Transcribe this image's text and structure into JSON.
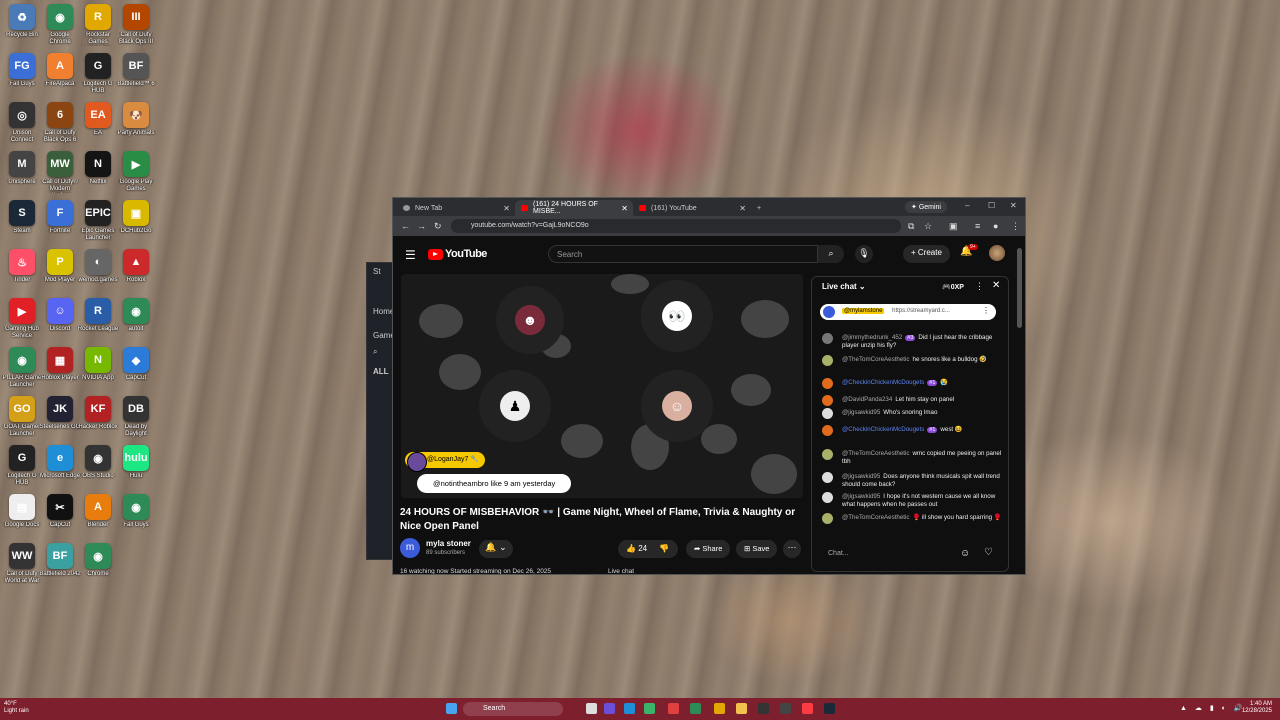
{
  "desktop": {
    "icons": [
      {
        "label": "Recycle Bin",
        "glyph": "♻",
        "color": "#4a7bb7"
      },
      {
        "label": "Google Chrome",
        "glyph": "◉",
        "color": "#2e8b57"
      },
      {
        "label": "Rockstar Games Launcher",
        "glyph": "R",
        "color": "#e0a800"
      },
      {
        "label": "Call of Duty Black Ops III",
        "glyph": "III",
        "color": "#b34700"
      },
      {
        "label": "Fall Guys",
        "glyph": "FG",
        "color": "#3b6fd6"
      },
      {
        "label": "FireAlpaca",
        "glyph": "A",
        "color": "#f08030"
      },
      {
        "label": "Logitech G HUB",
        "glyph": "G",
        "color": "#222222"
      },
      {
        "label": "Battlefield™ 6",
        "glyph": "BF",
        "color": "#555555"
      },
      {
        "label": "Unison Connect",
        "glyph": "◎",
        "color": "#333333"
      },
      {
        "label": "Call of Duty Black Ops 6",
        "glyph": "6",
        "color": "#8b4513"
      },
      {
        "label": "EA",
        "glyph": "EA",
        "color": "#e05a1f"
      },
      {
        "label": "Party Animals",
        "glyph": "🐶",
        "color": "#d98c3f"
      },
      {
        "label": "Unisphere",
        "glyph": "M",
        "color": "#444444"
      },
      {
        "label": "Call of Duty® Modern Warfare",
        "glyph": "MW",
        "color": "#3a5f3a"
      },
      {
        "label": "Netflix",
        "glyph": "N",
        "color": "#141414"
      },
      {
        "label": "Google Play Games",
        "glyph": "▶",
        "color": "#2a8d46"
      },
      {
        "label": "Steam",
        "glyph": "S",
        "color": "#1b2838"
      },
      {
        "label": "Fortnite",
        "glyph": "F",
        "color": "#3a6fd8"
      },
      {
        "label": "Epic Games Launcher",
        "glyph": "EPIC",
        "color": "#222222"
      },
      {
        "label": "DCHub2Go",
        "glyph": "▣",
        "color": "#d9b800"
      },
      {
        "label": "Tinder",
        "glyph": "♨",
        "color": "#fd5068"
      },
      {
        "label": "Mod Player",
        "glyph": "P",
        "color": "#d9c200"
      },
      {
        "label": "wemod.games",
        "glyph": "◐",
        "color": "#666666"
      },
      {
        "label": "Roblox",
        "glyph": "▲",
        "color": "#cc2a2a"
      },
      {
        "label": "Gaming Hub Service",
        "glyph": "▶",
        "color": "#e01f26"
      },
      {
        "label": "Discord",
        "glyph": "☺",
        "color": "#5865f2"
      },
      {
        "label": "Rocket League",
        "glyph": "R",
        "color": "#2a5da8"
      },
      {
        "label": "autoit",
        "glyph": "◉",
        "color": "#2e8b57"
      },
      {
        "label": "PILLAR Game Launcher",
        "glyph": "◉",
        "color": "#2e8b57"
      },
      {
        "label": "Roblox Player",
        "glyph": "▦",
        "color": "#b22222"
      },
      {
        "label": "NVIDIA App",
        "glyph": "N",
        "color": "#76b900"
      },
      {
        "label": "CapCut",
        "glyph": "◆",
        "color": "#2b7bd8"
      },
      {
        "label": "GOAT Gamer Launcher",
        "glyph": "GO",
        "color": "#d4a017"
      },
      {
        "label": "Steelseries GG",
        "glyph": "JK",
        "color": "#222233"
      },
      {
        "label": "Hacker Roblox",
        "glyph": "KF",
        "color": "#b22222"
      },
      {
        "label": "Dead by Daylight",
        "glyph": "DB",
        "color": "#333333"
      },
      {
        "label": "Logitech G HUB",
        "glyph": "G",
        "color": "#222222"
      },
      {
        "label": "Microsoft Edge",
        "glyph": "e",
        "color": "#1e8fd6"
      },
      {
        "label": "OBS Studio",
        "glyph": "◉",
        "color": "#333333"
      },
      {
        "label": "Hulu",
        "glyph": "hulu",
        "color": "#1ce783"
      },
      {
        "label": "Google Docs",
        "glyph": "▤",
        "color": "#eeeeee"
      },
      {
        "label": "CapCut",
        "glyph": "✂",
        "color": "#111111"
      },
      {
        "label": "Blender",
        "glyph": "A",
        "color": "#e87d0d"
      },
      {
        "label": "Fall Guys",
        "glyph": "◉",
        "color": "#2e8b57"
      },
      {
        "label": "Call of Duty World at War",
        "glyph": "WW",
        "color": "#333333"
      },
      {
        "label": "Battlefield 2042",
        "glyph": "BF",
        "color": "#3aa0a0"
      },
      {
        "label": "Chrome",
        "glyph": "◉",
        "color": "#2e8b57"
      }
    ]
  },
  "side_window": {
    "items": [
      "St",
      "Home",
      "Game",
      "ALL"
    ]
  },
  "browser": {
    "tabs": [
      {
        "label": "New Tab",
        "favicon": "gray"
      },
      {
        "label": "(161) 24 HOURS OF MISBE...",
        "favicon": "red"
      },
      {
        "label": "(161) YouTube",
        "favicon": "red"
      }
    ],
    "new_tab": "+",
    "gemini": "Gemini",
    "window_controls": [
      "–",
      "☐",
      "✕"
    ],
    "url": "youtube.com/watch?v=GajL9oNCO9o",
    "nav": [
      "←",
      "→",
      "↻"
    ]
  },
  "youtube": {
    "logo": "YouTube",
    "search_placeholder": "Search",
    "create_label": "Create",
    "notif_badge": "9+",
    "video": {
      "tag_user": "@LoganJay7",
      "caption": "@notintheambro like 9 am yesterday"
    },
    "title": "24 HOURS OF MISBEHAVIOR 👓 | Game Night, Wheel of Flame, Trivia & Naughty or Nice Open Panel",
    "channel": "myla stoner",
    "subscribers": "89 subscribers",
    "channel_initial": "m",
    "likes": "24",
    "share_label": "Share",
    "save_label": "Save",
    "description_preview": "16 watching now  Started streaming on Dec 26, 2025",
    "live_chat_bottom": "Live chat"
  },
  "chat": {
    "header": "Live chat",
    "points": "0XP",
    "pinned_user": "@mylamstone",
    "pinned_text": "https://streamyard.c...",
    "messages": [
      {
        "author": "@jimmythedrunk_452",
        "badge": "#3",
        "text": "Did I just hear the cribbage player unzip his fly?",
        "blue": false,
        "av": "#777"
      },
      {
        "author": "@TheTomCoreAesthetic",
        "badge": "",
        "text": "he snores like a bulldog 🤣",
        "blue": false,
        "av": "#a9b06a"
      },
      {
        "author": "@CheckinChickenMcDougets",
        "badge": "#1",
        "text": "😭",
        "blue": true,
        "av": "#e06b1f"
      },
      {
        "author": "@DavidPanda234",
        "badge": "",
        "text": "Let him stay on panel",
        "blue": false,
        "av": "#e06b1f"
      },
      {
        "author": "@jigsawkid95",
        "badge": "",
        "text": "Who's snoring lmao",
        "blue": false,
        "av": "#ddd"
      },
      {
        "author": "@CheckinChickenMcDougets",
        "badge": "#1",
        "text": "west 😆",
        "blue": true,
        "av": "#e06b1f"
      },
      {
        "author": "@TheTomCoreAesthetic",
        "badge": "",
        "text": "wmc copied me peeing on panel tbh",
        "blue": false,
        "av": "#a9b06a"
      },
      {
        "author": "@jigsawkid95",
        "badge": "",
        "text": "Does anyone think musicals spit wall trend should come back?",
        "blue": false,
        "av": "#ddd"
      },
      {
        "author": "@jigsawkid95",
        "badge": "",
        "text": "I hope it's not western cause we all know what happens when he passes out",
        "blue": false,
        "av": "#ddd"
      },
      {
        "author": "@TheTomCoreAesthetic",
        "badge": "",
        "text": "🥊 ill show you hard sparring 🥊",
        "blue": false,
        "av": "#a9b06a"
      }
    ],
    "input_placeholder": "Chat..."
  },
  "taskbar": {
    "weather_temp": "40°F",
    "weather_desc": "Light rain",
    "search_label": "Search",
    "time": "1:40 AM",
    "date": "12/28/2025"
  }
}
